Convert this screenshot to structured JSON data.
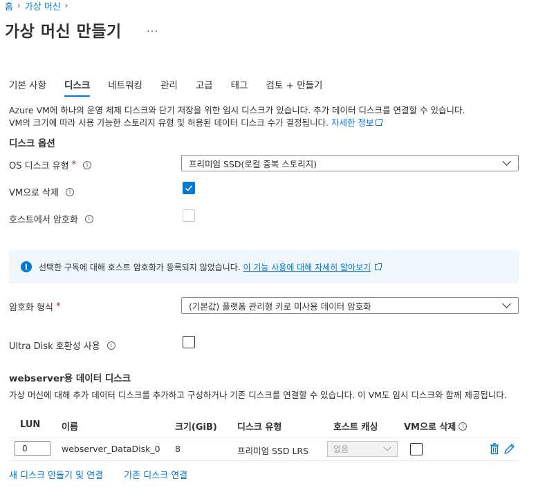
{
  "breadcrumb": {
    "home": "홈",
    "parent": "가상 머신"
  },
  "page_title": "가상 머신 만들기",
  "more_label": "...",
  "tabs": [
    {
      "label": "기본 사항",
      "active": false
    },
    {
      "label": "디스크",
      "active": true
    },
    {
      "label": "네트워킹",
      "active": false
    },
    {
      "label": "관리",
      "active": false
    },
    {
      "label": "고급",
      "active": false
    },
    {
      "label": "태그",
      "active": false
    },
    {
      "label": "검토 + 만들기",
      "active": false
    }
  ],
  "description": {
    "line1": "Azure VM에 하나의 운영 체제 디스크와 단기 저장을 위한 임시 디스크가 있습니다. 추가 데이터 디스크를 연결할 수 있습니다.",
    "line2": "VM의 크기에 따라 사용 가능한 스토리지 유형 및 허용된 데이터 디스크 수가 결정됩니다.",
    "learn_more": "자세한 정보"
  },
  "disk_options": {
    "title": "디스크 옵션",
    "os_disk_type_label": "OS 디스크 유형",
    "os_disk_type_value": "프리미엄 SSD(로컬 중복 스토리지)",
    "delete_with_vm_label": "VM으로 삭제",
    "delete_with_vm_checked": true,
    "host_encryption_label": "호스트에서 암호화",
    "host_encryption_checked": false,
    "info_message": "선택한 구독에 대해 호스트 암호화가 등록되지 않았습니다.",
    "info_link": "이 기능 사용에 대해 자세히 알아보기",
    "encryption_type_label": "암호화 형식",
    "encryption_type_value": "(기본값) 플랫폼 관리형 키로 미사용 데이터 암호화",
    "ultra_disk_label": "Ultra Disk 호환성 사용",
    "ultra_disk_checked": false
  },
  "data_disks": {
    "title": "webserver용 데이터 디스크",
    "description": "가상 머신에 대해 추가 데이터 디스크를 추가하고 구성하거나 기존 디스크를 연결할 수 있습니다. 이 VM도 임시 디스크와 함께 제공됩니다.",
    "columns": {
      "lun": "LUN",
      "name": "이름",
      "size": "크기(GiB)",
      "disk_type": "디스크 유형",
      "host_caching": "호스트 캐싱",
      "delete_with_vm": "VM으로 삭제"
    },
    "rows": [
      {
        "lun": "0",
        "name": "webserver_DataDisk_0",
        "size": "8",
        "disk_type": "프리미엄 SSD LRS",
        "host_caching": "없음",
        "delete_with_vm": false
      }
    ],
    "create_attach_link": "새 디스크 만들기 및 연결",
    "attach_existing_link": "기존 디스크 연결"
  },
  "colors": {
    "accent": "#0078d4",
    "required": "#a4262c",
    "info_bg": "#eff6fc"
  },
  "icons": [
    "info-icon",
    "external-link-icon",
    "checkmark-icon",
    "chevron-down-icon",
    "trash-icon",
    "pencil-icon",
    "chevron-right-icon"
  ]
}
